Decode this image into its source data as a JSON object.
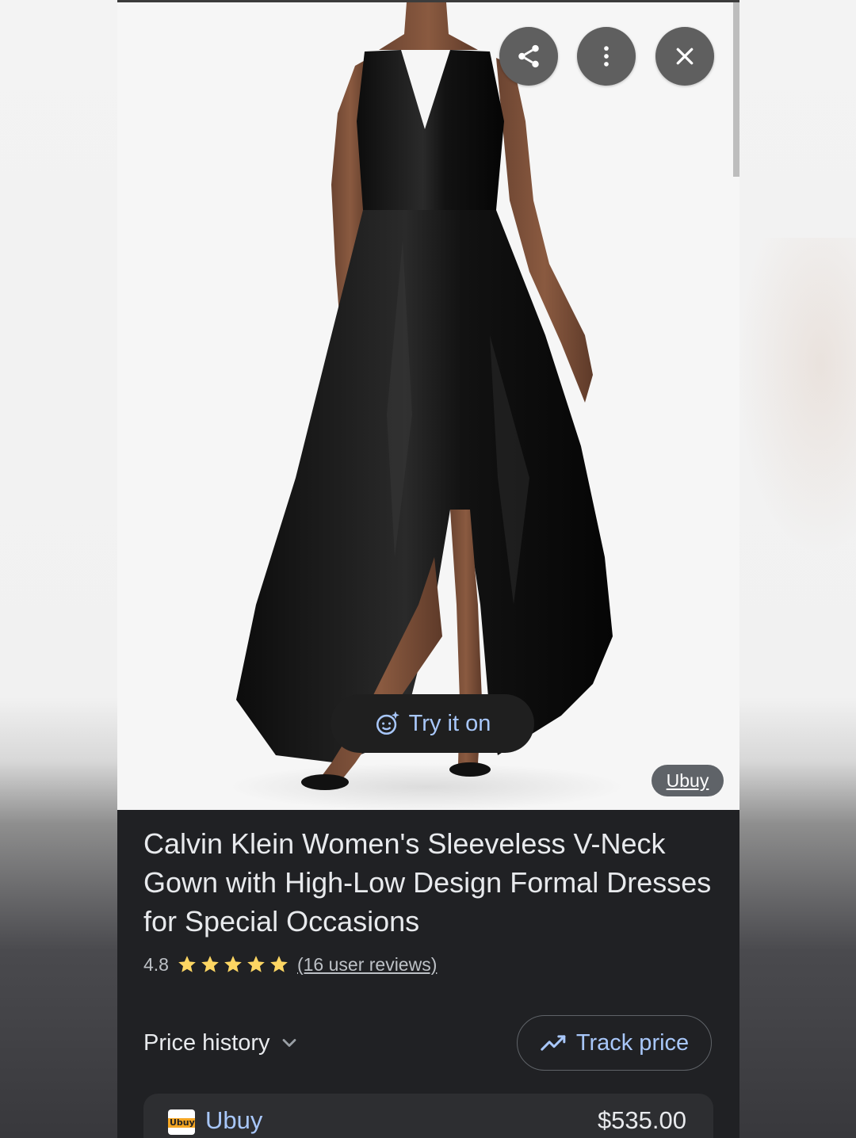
{
  "header": {
    "share_icon": "share-icon",
    "more_icon": "more-vert-icon",
    "close_icon": "close-icon"
  },
  "image": {
    "try_on_label": "Try it on",
    "try_on_icon": "face-sparkle-icon",
    "source_chip": "Ubuy"
  },
  "product": {
    "title": "Calvin Klein Women's Sleeveless V-Neck Gown with High-Low Design Formal Dresses for Special Occasions",
    "rating": "4.8",
    "rating_stars": 5,
    "reviews_link": "(16 user reviews)"
  },
  "price_section": {
    "history_label": "Price history",
    "track_label": "Track price",
    "track_icon": "trending-up-icon"
  },
  "offers": [
    {
      "store": "Ubuy",
      "logo_text": "Ubuy",
      "price": "$535.00"
    }
  ],
  "colors": {
    "accent": "#a8c7fa",
    "star": "#fdd663",
    "panel": "#202124"
  }
}
